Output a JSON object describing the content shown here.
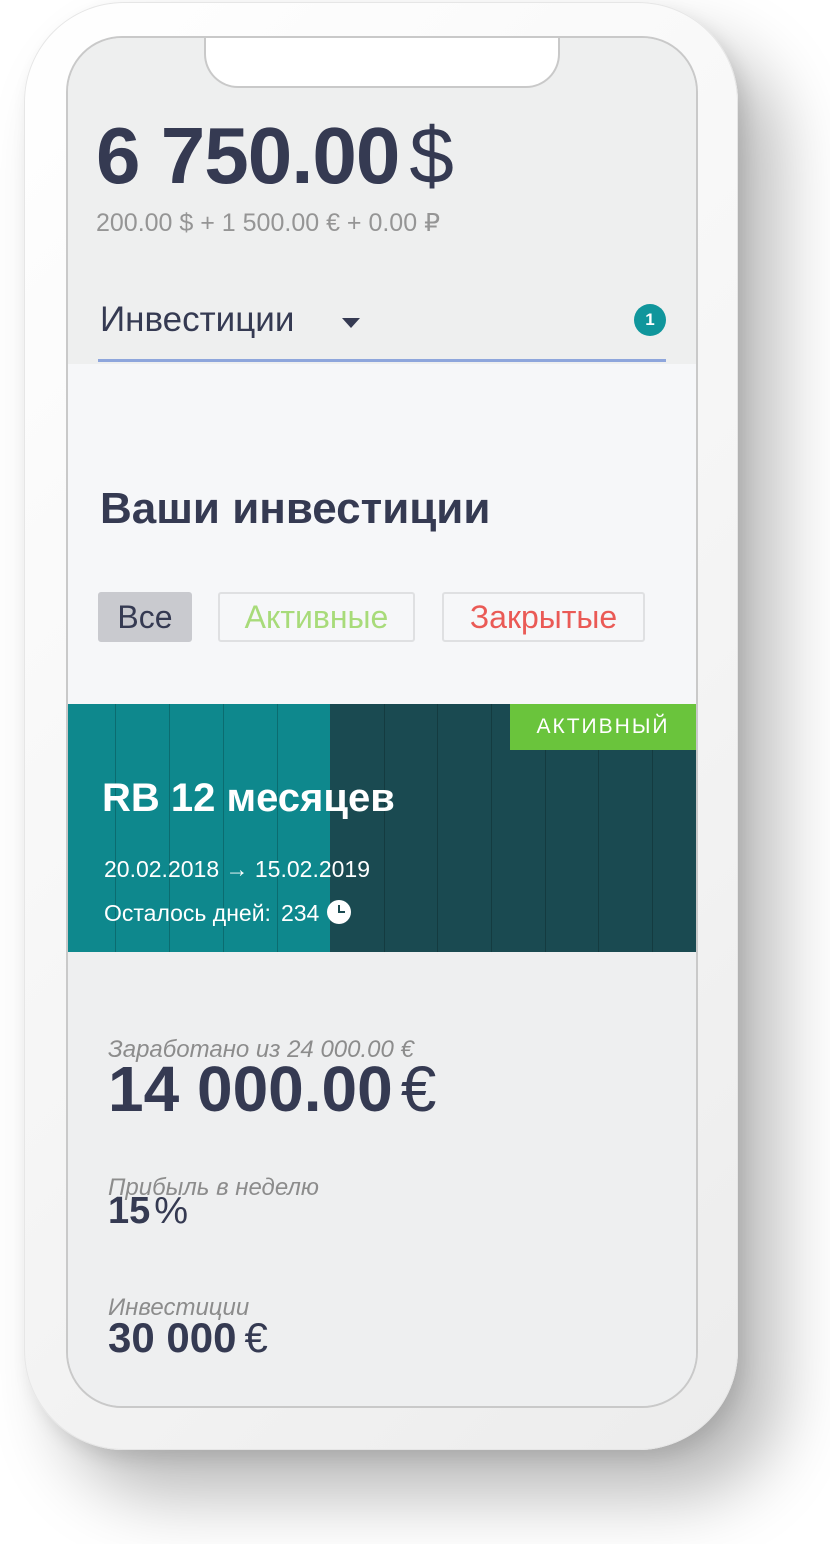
{
  "header": {
    "balance_amount": "6 750.00",
    "balance_currency": "$",
    "balance_breakdown": "200.00 $ + 1 500.00 € + 0.00 ₽"
  },
  "nav": {
    "selected": "Инвестиции",
    "notification_count": "1"
  },
  "investments": {
    "title": "Ваши инвестиции",
    "filters": [
      "Все",
      "Активные",
      "Закрытые"
    ],
    "selected_filter": "Все"
  },
  "card": {
    "status": "АКТИВНЫЙ",
    "title": "RB 12 месяцев",
    "dates": "20.02.2018 → 15.02.2019",
    "days_left_label": "Осталось дней:",
    "days_left": "234",
    "icon": "clock-icon"
  },
  "stats": {
    "earned_label": "Заработано из 24 000.00 €",
    "earned_amount": "14 000.00",
    "earned_currency": "€",
    "weekly_label": "Прибыль в неделю",
    "weekly_value": "15",
    "weekly_unit": "%",
    "investment_label": "Инвестиции",
    "investment_amount": "30 000",
    "investment_currency": "€"
  },
  "colors": {
    "primary_text": "#353a52",
    "accent_teal": "#0e888d",
    "card_dark": "#1a4a51",
    "active_green": "#6ac43c",
    "active_text": "#a8db7a",
    "closed_red": "#ea5a56",
    "underline": "#8ea6dc"
  }
}
